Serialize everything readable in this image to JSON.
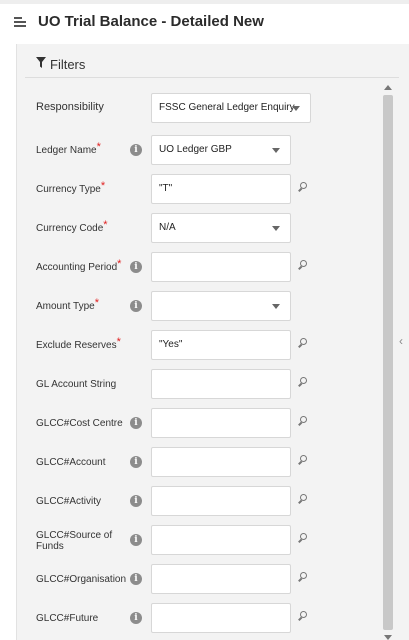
{
  "header": {
    "title": "UO Trial Balance - Detailed New"
  },
  "filters": {
    "label": "Filters"
  },
  "responsibility": {
    "label": "Responsibility",
    "value": "FSSC General Ledger Enquiry"
  },
  "fields": [
    {
      "label": "Ledger Name",
      "required": "*",
      "value": "UO Ledger GBP"
    },
    {
      "label": "Currency Type",
      "required": "*",
      "value": "\"T\""
    },
    {
      "label": "Currency Code",
      "required": "*",
      "value": "N/A"
    },
    {
      "label": "Accounting Period",
      "required": "*",
      "value": ""
    },
    {
      "label": "Amount Type",
      "required": "*",
      "value": ""
    },
    {
      "label": "Exclude Reserves",
      "required": "*",
      "value": "\"Yes\""
    },
    {
      "label": "GL Account String",
      "required": "",
      "value": ""
    },
    {
      "label": "GLCC#Cost Centre",
      "required": "",
      "value": ""
    },
    {
      "label": "GLCC#Account",
      "required": "",
      "value": ""
    },
    {
      "label": "GLCC#Activity",
      "required": "",
      "value": ""
    },
    {
      "label": "GLCC#Source of Funds",
      "required": "",
      "value": ""
    },
    {
      "label": "GLCC#Organisation",
      "required": "",
      "value": ""
    },
    {
      "label": "GLCC#Future",
      "required": "",
      "value": ""
    }
  ],
  "icons": {
    "info": "info-icon",
    "search": "search-icon",
    "dropdown": "chevron-down-icon",
    "filter": "filter-icon",
    "menu": "menu-icon",
    "collapse": "chevron-left-icon"
  }
}
